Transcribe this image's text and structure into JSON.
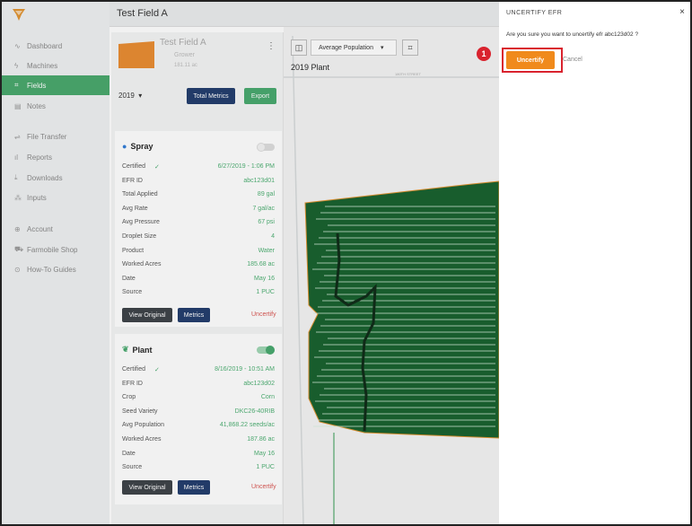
{
  "app": {
    "title": "Test Field A"
  },
  "nav": {
    "items": [
      {
        "label": "Dashboard",
        "icon": "pulse-icon"
      },
      {
        "label": "Machines",
        "icon": "bolt-icon"
      },
      {
        "label": "Fields",
        "icon": "grid-icon"
      },
      {
        "label": "Notes",
        "icon": "note-icon"
      },
      {
        "label": "File Transfer",
        "icon": "transfer-icon"
      },
      {
        "label": "Reports",
        "icon": "bars-icon"
      },
      {
        "label": "Downloads",
        "icon": "download-icon"
      },
      {
        "label": "Inputs",
        "icon": "inputs-icon"
      },
      {
        "label": "Account",
        "icon": "account-icon"
      },
      {
        "label": "Farmobile Shop",
        "icon": "cart-icon"
      },
      {
        "label": "How-To Guides",
        "icon": "help-icon"
      }
    ],
    "active": "Fields"
  },
  "field": {
    "name": "Test Field A",
    "sub": "Grower",
    "acres": "181.11 ac",
    "year": "2019",
    "total_metrics_label": "Total Metrics",
    "export_label": "Export"
  },
  "spray": {
    "title": "Spray",
    "rows": [
      {
        "k": "Certified",
        "v": "6/27/2019 - 1:06 PM"
      },
      {
        "k": "EFR ID",
        "v": "abc123d01"
      },
      {
        "k": "Total Applied",
        "v": "89 gal"
      },
      {
        "k": "Avg Rate",
        "v": "7 gal/ac"
      },
      {
        "k": "Avg Pressure",
        "v": "67 psi"
      },
      {
        "k": "Droplet Size",
        "v": "4"
      },
      {
        "k": "Product",
        "v": "Water"
      },
      {
        "k": "Worked Acres",
        "v": "185.68 ac"
      },
      {
        "k": "Date",
        "v": "May 16"
      },
      {
        "k": "Source",
        "v": "1 PUC"
      }
    ],
    "view_label": "View Original",
    "metrics_label": "Metrics",
    "uncertify_label": "Uncertify"
  },
  "plant": {
    "title": "Plant",
    "rows": [
      {
        "k": "Certified",
        "v": "8/16/2019 - 10:51 AM"
      },
      {
        "k": "EFR ID",
        "v": "abc123d02"
      },
      {
        "k": "Crop",
        "v": "Corn"
      },
      {
        "k": "Seed Variety",
        "v": "DKC26-40RIB"
      },
      {
        "k": "Avg Population",
        "v": "41,868.22 seeds/ac"
      },
      {
        "k": "Worked Acres",
        "v": "187.86 ac"
      },
      {
        "k": "Date",
        "v": "May 16"
      },
      {
        "k": "Source",
        "v": "1 PUC"
      }
    ],
    "view_label": "View Original",
    "metrics_label": "Metrics",
    "uncertify_label": "Uncertify"
  },
  "map": {
    "layer_select": "Average Population",
    "label": "2019 Plant",
    "street": "180TH STREET"
  },
  "dialog": {
    "title": "UNCERTIFY EFR",
    "close": "×",
    "question": "Are you sure you want to uncertify efr  abc123d02  ?",
    "confirm_label": "Uncertify",
    "cancel_label": "Cancel"
  },
  "callout": {
    "number": "1"
  },
  "colors": {
    "brand_green": "#46a66a",
    "navy": "#1f3a6b",
    "accent_orange": "#f08a1c",
    "callout_red": "#d9232e"
  }
}
